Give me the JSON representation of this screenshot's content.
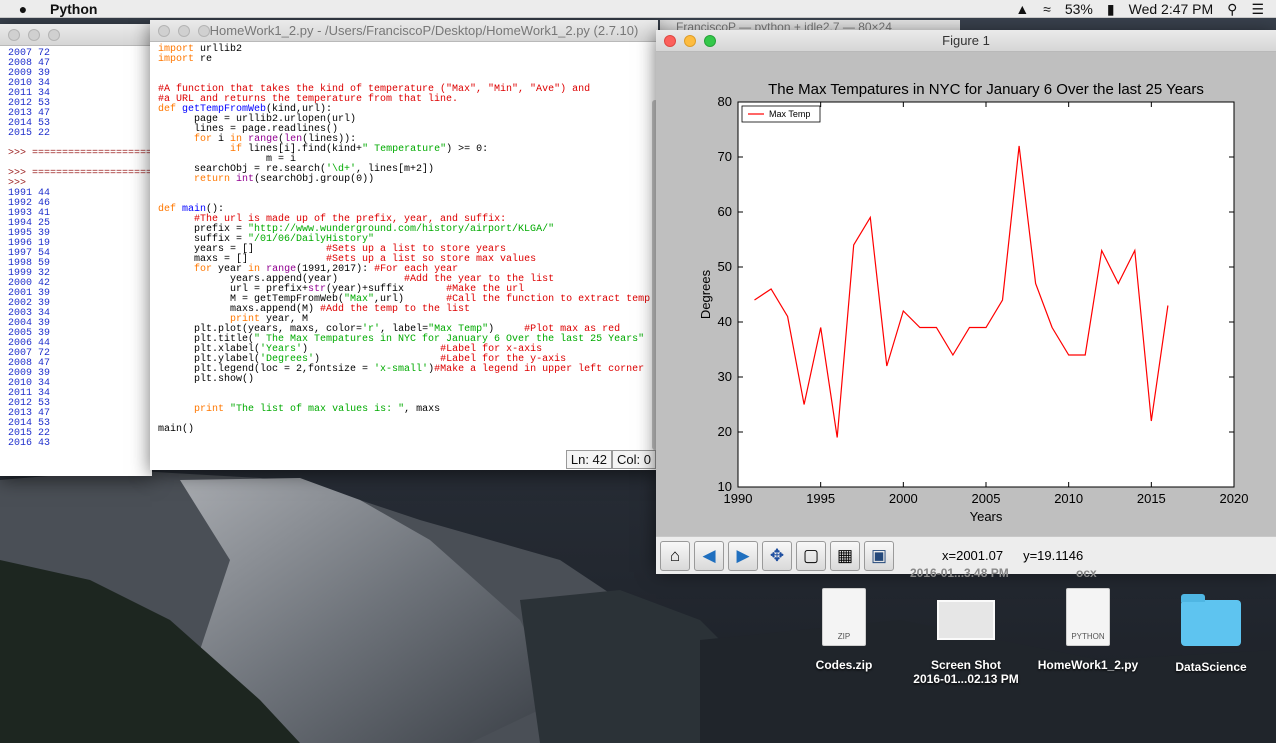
{
  "menubar": {
    "apple_icon": "apple-icon",
    "app_name": "Python",
    "battery": "53%",
    "clock": "Wed 2:47 PM"
  },
  "shell": {
    "lines": [
      "2007 72",
      "2008 47",
      "2009 39",
      "2010 34",
      "2011 34",
      "2012 53",
      "2013 47",
      "2014 53",
      "2015 22",
      "",
      ">>> ====================",
      "",
      ">>> ====================",
      ">>>",
      "1991 44",
      "1992 46",
      "1993 41",
      "1994 25",
      "1995 39",
      "1996 19",
      "1997 54",
      "1998 59",
      "1999 32",
      "2000 42",
      "2001 39",
      "2002 39",
      "2003 34",
      "2004 39",
      "2005 39",
      "2006 44",
      "2007 72",
      "2008 47",
      "2009 39",
      "2010 34",
      "2011 34",
      "2012 53",
      "2013 47",
      "2014 53",
      "2015 22",
      "2016 43"
    ]
  },
  "editor": {
    "title": "HomeWork1_2.py - /Users/FranciscoP/Desktop/HomeWork1_2.py (2.7.10)",
    "ln": "Ln: 42",
    "col": "Col: 0",
    "background_title": "FranciscoP — python + idle2.7 — 80×24"
  },
  "figure": {
    "window_title": "Figure 1",
    "coord_x": "x=2001.07",
    "coord_y": "y=19.1146",
    "toolbar_icons": [
      "home-icon",
      "back-icon",
      "forward-icon",
      "pan-icon",
      "zoom-icon",
      "subplots-icon",
      "save-icon"
    ]
  },
  "chart_data": {
    "type": "line",
    "title": "The Max Tempatures in NYC for January 6 Over the last 25 Years",
    "xlabel": "Years",
    "ylabel": "Degrees",
    "xlim": [
      1990,
      2020
    ],
    "ylim": [
      10,
      80
    ],
    "xticks": [
      1990,
      1995,
      2000,
      2005,
      2010,
      2015,
      2020
    ],
    "yticks": [
      10,
      20,
      30,
      40,
      50,
      60,
      70,
      80
    ],
    "grid": false,
    "legend": "upper left",
    "series": [
      {
        "name": "Max Temp",
        "color": "#ff0000",
        "x": [
          1991,
          1992,
          1993,
          1994,
          1995,
          1996,
          1997,
          1998,
          1999,
          2000,
          2001,
          2002,
          2003,
          2004,
          2005,
          2006,
          2007,
          2008,
          2009,
          2010,
          2011,
          2012,
          2013,
          2014,
          2015,
          2016
        ],
        "y": [
          44,
          46,
          41,
          25,
          39,
          19,
          54,
          59,
          32,
          42,
          39,
          39,
          34,
          39,
          39,
          44,
          72,
          47,
          39,
          34,
          34,
          53,
          47,
          53,
          22,
          43
        ]
      }
    ]
  },
  "desktop": {
    "ghost_label_1": "2016-01...3.48 PM",
    "ghost_label_2": "ocx",
    "icons": [
      {
        "label": "Codes.zip",
        "tag": "ZIP"
      },
      {
        "label": "Screen Shot",
        "label2": "2016-01...02.13 PM"
      },
      {
        "label": "HomeWork1_2.py",
        "tag": "PYTHON"
      },
      {
        "label": "DataScience"
      }
    ]
  }
}
